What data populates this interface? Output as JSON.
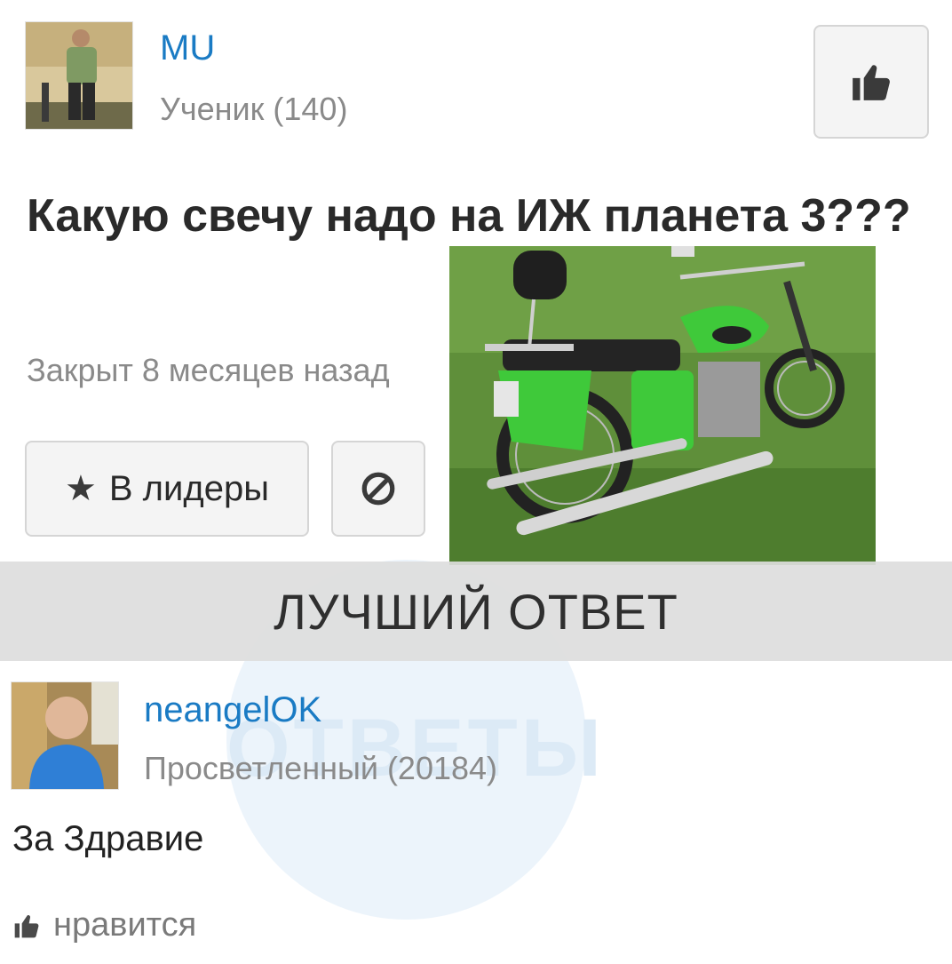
{
  "question": {
    "author": {
      "username": "MU",
      "rank": "Ученик (140)"
    },
    "title": "Какую свечу надо на ИЖ планета 3???",
    "status": "Закрыт 8 месяцев назад",
    "buttons": {
      "leaders_label": "В лидеры",
      "leaders_icon": "star-icon",
      "block_icon": "prohibited-icon",
      "like_icon": "thumbs-up-icon"
    }
  },
  "best_answer": {
    "header": "ЛУЧШИЙ ОТВЕТ",
    "author": {
      "username": "neangelOK",
      "rank": "Просветленный (20184)"
    },
    "text": "За Здравие",
    "like_label": "нравится",
    "like_icon": "thumbs-up-icon"
  },
  "watermark": "ОТВЕТЫ",
  "colors": {
    "link": "#1a7bc4",
    "muted": "#8a8a8a",
    "bar": "#dddddd",
    "motorcycle": "#3fc93a"
  }
}
